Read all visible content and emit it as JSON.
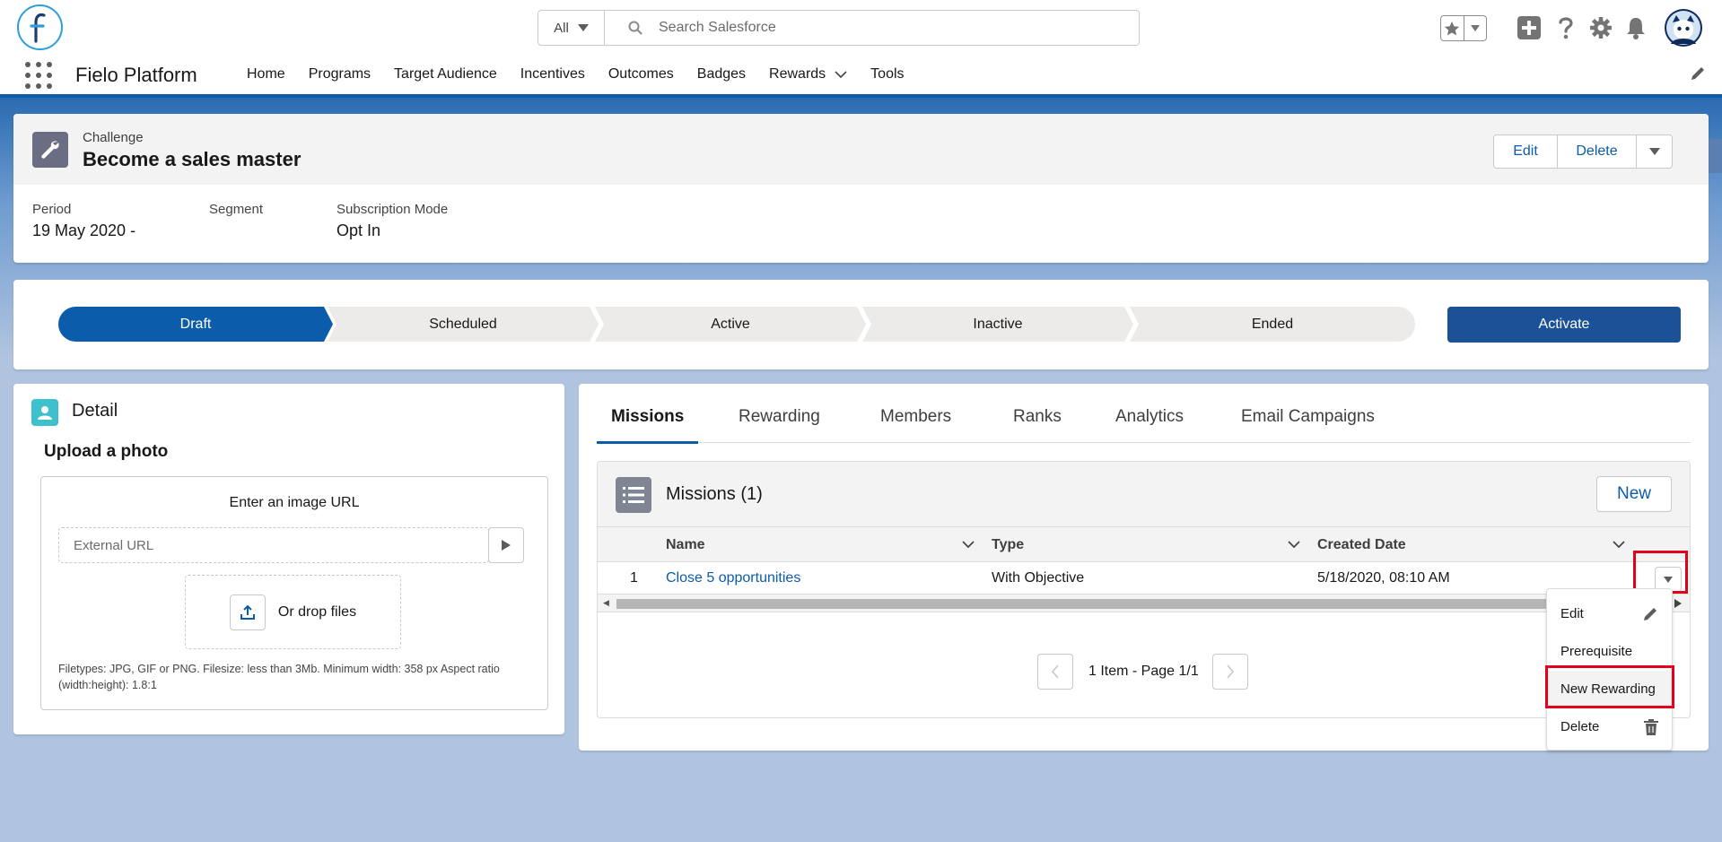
{
  "header": {
    "search_scope": "All",
    "search_placeholder": "Search Salesforce"
  },
  "icons": {
    "logo": "fielo-logo",
    "favorites": "star-icon",
    "add": "plus-icon",
    "help": "question-icon",
    "setup": "gear-icon",
    "notifications": "bell-icon",
    "avatar": "astro-avatar"
  },
  "nav": {
    "app_name": "Fielo Platform",
    "items": [
      "Home",
      "Programs",
      "Target Audience",
      "Incentives",
      "Outcomes",
      "Badges",
      "Rewards",
      "Tools"
    ]
  },
  "record": {
    "type": "Challenge",
    "title": "Become a sales master",
    "actions": {
      "edit": "Edit",
      "delete": "Delete"
    },
    "fields": {
      "period_label": "Period",
      "period_value": "19 May 2020 -",
      "segment_label": "Segment",
      "segment_value": "",
      "subscription_label": "Subscription Mode",
      "subscription_value": "Opt In"
    }
  },
  "path": {
    "steps": [
      "Draft",
      "Scheduled",
      "Active",
      "Inactive",
      "Ended"
    ],
    "current": "Draft",
    "activate_label": "Activate"
  },
  "detail": {
    "title": "Detail",
    "upload_title": "Upload a photo",
    "enter_url": "Enter an image URL",
    "url_placeholder": "External URL",
    "drop_label": "Or drop files",
    "filetypes": "Filetypes: JPG, GIF or PNG. Filesize: less than 3Mb. Minimum width: 358 px Aspect ratio (width:height): 1.8:1"
  },
  "tabs": {
    "items": [
      "Missions",
      "Rewarding",
      "Members",
      "Ranks",
      "Analytics",
      "Email Campaigns"
    ],
    "active": "Missions"
  },
  "missions": {
    "title": "Missions (1)",
    "new_label": "New",
    "columns": [
      "Name",
      "Type",
      "Created Date"
    ],
    "rows": [
      {
        "num": "1",
        "name": "Close 5 opportunities",
        "type": "With Objective",
        "created": "5/18/2020, 08:10 AM"
      }
    ],
    "pager_text": "1 Item - Page 1/1"
  },
  "row_menu": {
    "items": [
      "Edit",
      "Prerequisite",
      "New Rewarding",
      "Delete"
    ],
    "highlighted": "New Rewarding"
  },
  "colors": {
    "brand": "#0b5cab",
    "activate": "#1b5297",
    "highlight": "#e3001b",
    "detail_icon": "#3ec1cc"
  }
}
